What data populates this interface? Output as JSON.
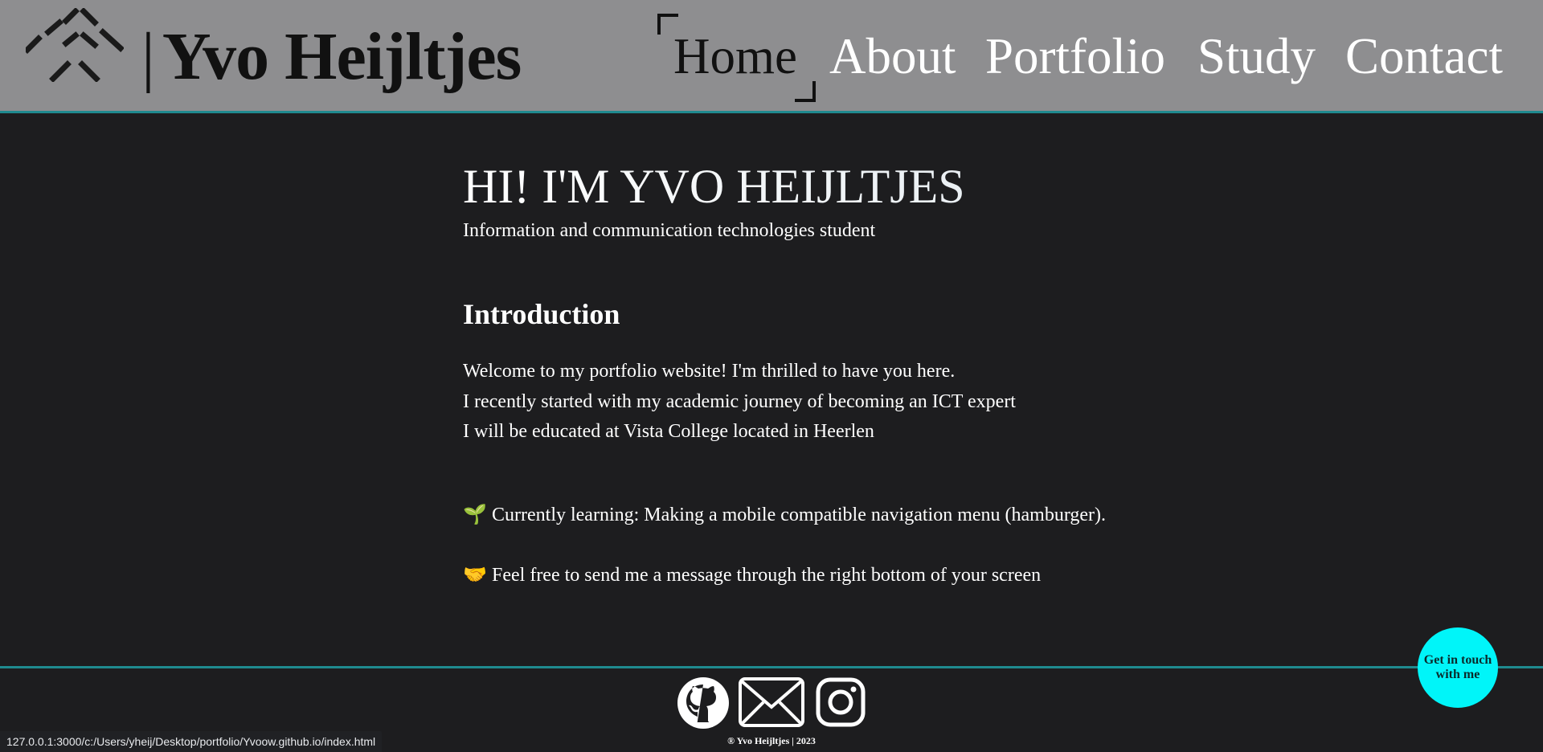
{
  "header": {
    "brand_separator": "|",
    "brand_name": "Yvo Heijltjes",
    "nav": [
      {
        "label": "Home",
        "active": true
      },
      {
        "label": "About"
      },
      {
        "label": "Portfolio"
      },
      {
        "label": "Study"
      },
      {
        "label": "Contact"
      }
    ]
  },
  "hero": {
    "title": "HI! I'M YVO HEIJLTJES",
    "subtitle": "Information and communication technologies student"
  },
  "intro": {
    "title": "Introduction",
    "lines": [
      "Welcome to my portfolio website! I'm thrilled to have you here.",
      "I recently started with my academic journey of becoming an ICT expert",
      "I will be educated at Vista College located in Heerlen"
    ]
  },
  "notes": [
    {
      "emoji": "🌱",
      "text": "Currently learning: Making a mobile compatible navigation menu (hamburger)."
    },
    {
      "emoji": "🤝",
      "text": "Feel free to send me a message through the right bottom of your screen"
    }
  ],
  "footer": {
    "social_icons": [
      "github-icon",
      "mail-icon",
      "instagram-icon"
    ],
    "copyright": "® Yvo Heijltjes | 2023"
  },
  "contact_bubble": {
    "label": "Get in touch with me"
  },
  "status_bar": {
    "url": "127.0.0.1:3000/c:/Users/yheij/Desktop/portfolio/Yvoow.github.io/index.html"
  },
  "colors": {
    "header_bg": "#8e8e90",
    "page_bg": "#1d1d1f",
    "accent_line": "#1f8a8f",
    "bubble": "#00f5f9"
  }
}
